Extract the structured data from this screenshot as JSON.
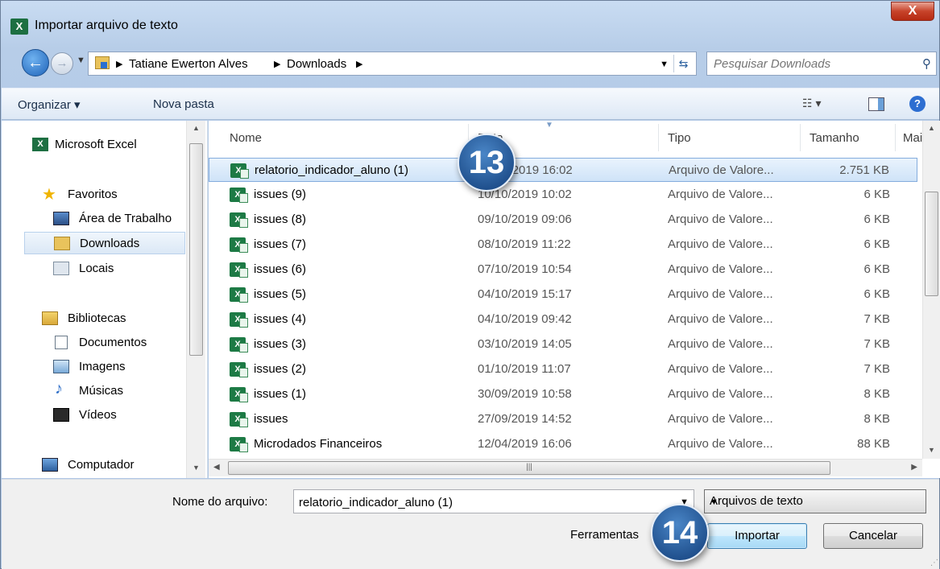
{
  "window": {
    "title": "Importar arquivo de texto",
    "app_icon": "excel-icon",
    "close_label": "X"
  },
  "nav": {
    "breadcrumb": [
      "Tatiane Ewerton Alves",
      "Downloads"
    ],
    "search_placeholder": "Pesquisar Downloads"
  },
  "toolbar": {
    "organize_label": "Organizar ▾",
    "new_folder_label": "Nova pasta",
    "view_label": "☷ ▾",
    "help_label": "?"
  },
  "sidebar": {
    "items": [
      {
        "label": "Microsoft Excel",
        "icon": "excel-icon"
      },
      {
        "label": "Favoritos",
        "icon": "star-icon"
      },
      {
        "label": "Área de Trabalho",
        "icon": "desktop-icon"
      },
      {
        "label": "Downloads",
        "icon": "downloads-folder-icon",
        "selected": true
      },
      {
        "label": "Locais",
        "icon": "recent-places-icon"
      },
      {
        "label": "Bibliotecas",
        "icon": "libraries-icon"
      },
      {
        "label": "Documentos",
        "icon": "documents-icon"
      },
      {
        "label": "Imagens",
        "icon": "pictures-icon"
      },
      {
        "label": "Músicas",
        "icon": "music-icon"
      },
      {
        "label": "Vídeos",
        "icon": "videos-icon"
      },
      {
        "label": "Computador",
        "icon": "computer-icon"
      }
    ]
  },
  "filelist": {
    "columns": {
      "name": "Nome",
      "date": "Data",
      "type": "Tipo",
      "size": "Tamanho",
      "more": "Mai"
    },
    "rows": [
      {
        "name": "relatorio_indicador_aluno (1)",
        "date": "10/10/2019 16:02",
        "type": "Arquivo de Valore...",
        "size": "2.751 KB",
        "selected": true
      },
      {
        "name": "issues (9)",
        "date": "10/10/2019 10:02",
        "type": "Arquivo de Valore...",
        "size": "6 KB"
      },
      {
        "name": "issues (8)",
        "date": "09/10/2019 09:06",
        "type": "Arquivo de Valore...",
        "size": "6 KB"
      },
      {
        "name": "issues (7)",
        "date": "08/10/2019 11:22",
        "type": "Arquivo de Valore...",
        "size": "6 KB"
      },
      {
        "name": "issues (6)",
        "date": "07/10/2019 10:54",
        "type": "Arquivo de Valore...",
        "size": "6 KB"
      },
      {
        "name": "issues (5)",
        "date": "04/10/2019 15:17",
        "type": "Arquivo de Valore...",
        "size": "6 KB"
      },
      {
        "name": "issues (4)",
        "date": "04/10/2019 09:42",
        "type": "Arquivo de Valore...",
        "size": "7 KB"
      },
      {
        "name": "issues (3)",
        "date": "03/10/2019 14:05",
        "type": "Arquivo de Valore...",
        "size": "7 KB"
      },
      {
        "name": "issues (2)",
        "date": "01/10/2019 11:07",
        "type": "Arquivo de Valore...",
        "size": "7 KB"
      },
      {
        "name": "issues (1)",
        "date": "30/09/2019 10:58",
        "type": "Arquivo de Valore...",
        "size": "8 KB"
      },
      {
        "name": "issues",
        "date": "27/09/2019 14:52",
        "type": "Arquivo de Valore...",
        "size": "8 KB"
      },
      {
        "name": "Microdados Financeiros",
        "date": "12/04/2019 16:06",
        "type": "Arquivo de Valore...",
        "size": "88 KB"
      }
    ]
  },
  "bottom": {
    "filename_label": "Nome do arquivo:",
    "filename_value": "relatorio_indicador_aluno (1)",
    "filetype_value": "Arquivos de texto",
    "tools_label": "Ferramentas",
    "import_label": "Importar",
    "cancel_label": "Cancelar"
  },
  "badges": {
    "step_a": "13",
    "step_b": "14"
  },
  "colors": {
    "badge": "#2a5fa0",
    "selection": "#cfe3f8",
    "excel": "#1d7a45"
  }
}
